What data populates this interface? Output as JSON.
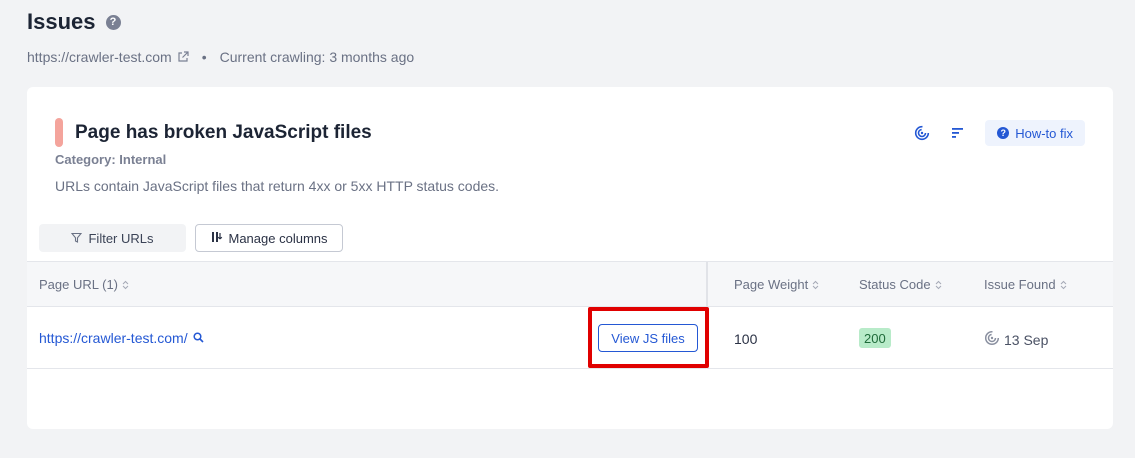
{
  "header": {
    "title": "Issues",
    "help_glyph": "?",
    "site_url": "https://crawler-test.com",
    "bullet": "•",
    "crawl_status": "Current crawling: 3 months ago"
  },
  "issue": {
    "title": "Page has broken JavaScript files",
    "category": "Category: Internal",
    "description": "URLs contain JavaScript files that return 4xx or 5xx HTTP status codes.",
    "marker_color": "#f4a49c",
    "how_to_fix_label": "How-to fix",
    "how_to_fix_glyph": "?"
  },
  "toolbar": {
    "filter_label": "Filter URLs",
    "manage_columns_label": "Manage columns"
  },
  "table": {
    "columns": [
      "Page URL (1)",
      "Page Weight",
      "Status Code",
      "Issue Found"
    ],
    "rows": [
      {
        "url": "https://crawler-test.com/",
        "action_label": "View JS files",
        "page_weight": "100",
        "status_code": "200",
        "issue_found": "13 Sep"
      }
    ]
  },
  "colors": {
    "accent": "#2458d4",
    "highlight": "#e00000",
    "status_ok_bg": "#b8ebc9"
  },
  "icons": [
    "help-icon",
    "external-link-icon",
    "history-icon",
    "sort-icon",
    "filter-icon",
    "columns-icon",
    "search-icon",
    "column-sort-icon"
  ]
}
